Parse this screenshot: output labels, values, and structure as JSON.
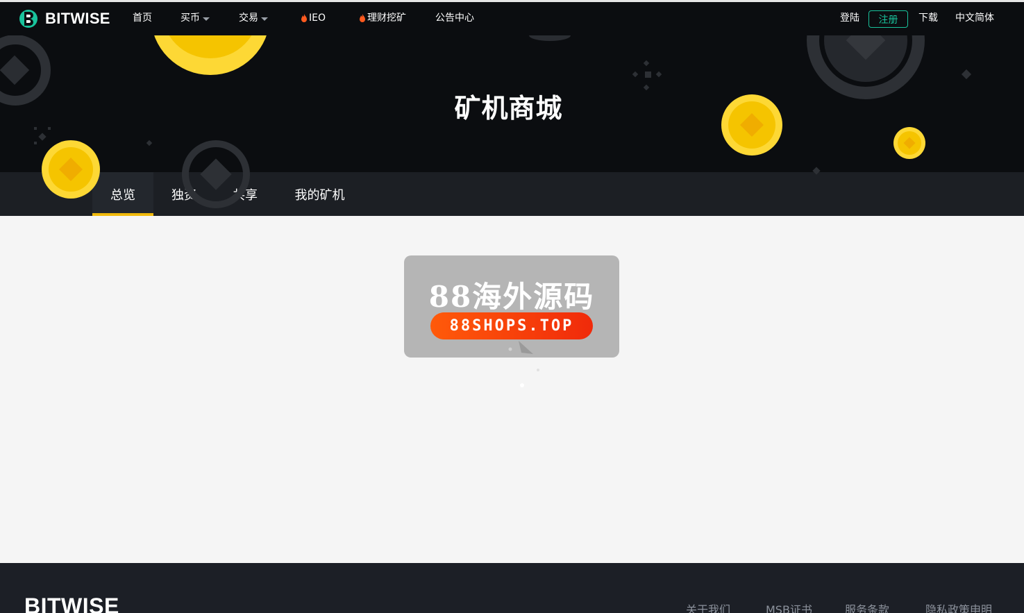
{
  "header": {
    "logo_text": "BITWISE",
    "nav": {
      "home": "首页",
      "buy": "买币",
      "trade": "交易",
      "ieo": "IEO",
      "mining": "理财挖矿",
      "notice": "公告中心"
    },
    "login": "登陆",
    "register": "注册",
    "download": "下载",
    "language": "中文简体"
  },
  "hero": {
    "title": "矿机商城"
  },
  "tabs": [
    {
      "label": "总览",
      "active": true
    },
    {
      "label": "独资",
      "active": false
    },
    {
      "label": "共享",
      "active": false
    },
    {
      "label": "我的矿机",
      "active": false
    }
  ],
  "watermark": {
    "title": "88海外源码",
    "site": "88SHOPS.TOP"
  },
  "footer": {
    "logo_text": "BITWISE",
    "links": [
      "关于我们",
      "MSB证书",
      "服务条款",
      "隐私政策申明"
    ]
  },
  "colors": {
    "accent_green": "#19c39c",
    "accent_yellow": "#f0b90b",
    "dark_bg": "#0b0d10",
    "tab_bg": "#1c1f24"
  }
}
